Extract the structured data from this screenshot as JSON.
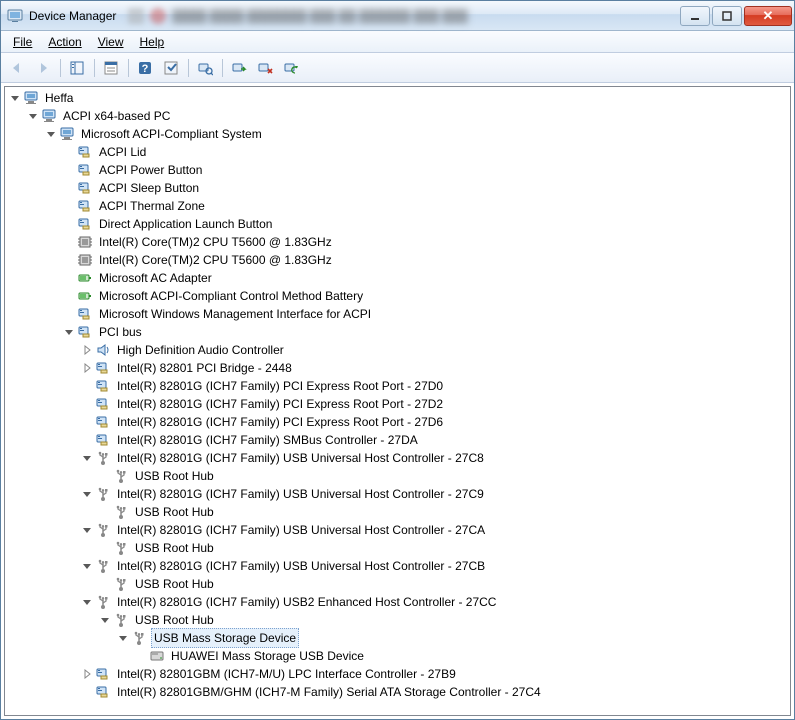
{
  "window": {
    "title": "Device Manager"
  },
  "menu": {
    "file": "File",
    "action": "Action",
    "view": "View",
    "help": "Help"
  },
  "tree": [
    {
      "depth": 0,
      "exp": "open",
      "icon": "computer",
      "label": "Heffa"
    },
    {
      "depth": 1,
      "exp": "open",
      "icon": "computer",
      "label": "ACPI x64-based PC"
    },
    {
      "depth": 2,
      "exp": "open",
      "icon": "computer",
      "label": "Microsoft ACPI-Compliant System"
    },
    {
      "depth": 3,
      "exp": "none",
      "icon": "system",
      "label": "ACPI Lid"
    },
    {
      "depth": 3,
      "exp": "none",
      "icon": "system",
      "label": "ACPI Power Button"
    },
    {
      "depth": 3,
      "exp": "none",
      "icon": "system",
      "label": "ACPI Sleep Button"
    },
    {
      "depth": 3,
      "exp": "none",
      "icon": "system",
      "label": "ACPI Thermal Zone"
    },
    {
      "depth": 3,
      "exp": "none",
      "icon": "system",
      "label": "Direct Application Launch Button"
    },
    {
      "depth": 3,
      "exp": "none",
      "icon": "cpu",
      "label": "Intel(R) Core(TM)2 CPU          T5600  @ 1.83GHz"
    },
    {
      "depth": 3,
      "exp": "none",
      "icon": "cpu",
      "label": "Intel(R) Core(TM)2 CPU          T5600  @ 1.83GHz"
    },
    {
      "depth": 3,
      "exp": "none",
      "icon": "battery",
      "label": "Microsoft AC Adapter"
    },
    {
      "depth": 3,
      "exp": "none",
      "icon": "battery",
      "label": "Microsoft ACPI-Compliant Control Method Battery"
    },
    {
      "depth": 3,
      "exp": "none",
      "icon": "system",
      "label": "Microsoft Windows Management Interface for ACPI"
    },
    {
      "depth": 3,
      "exp": "open",
      "icon": "system",
      "label": "PCI bus"
    },
    {
      "depth": 4,
      "exp": "closed",
      "icon": "sound",
      "label": "High Definition Audio Controller"
    },
    {
      "depth": 4,
      "exp": "closed",
      "icon": "system",
      "label": "Intel(R) 82801 PCI Bridge - 2448"
    },
    {
      "depth": 4,
      "exp": "none",
      "icon": "system",
      "label": "Intel(R) 82801G (ICH7 Family) PCI Express Root Port - 27D0"
    },
    {
      "depth": 4,
      "exp": "none",
      "icon": "system",
      "label": "Intel(R) 82801G (ICH7 Family) PCI Express Root Port - 27D2"
    },
    {
      "depth": 4,
      "exp": "none",
      "icon": "system",
      "label": "Intel(R) 82801G (ICH7 Family) PCI Express Root Port - 27D6"
    },
    {
      "depth": 4,
      "exp": "none",
      "icon": "system",
      "label": "Intel(R) 82801G (ICH7 Family) SMBus Controller - 27DA"
    },
    {
      "depth": 4,
      "exp": "open",
      "icon": "usb",
      "label": "Intel(R) 82801G (ICH7 Family) USB Universal Host Controller - 27C8"
    },
    {
      "depth": 5,
      "exp": "none",
      "icon": "usb",
      "label": "USB Root Hub"
    },
    {
      "depth": 4,
      "exp": "open",
      "icon": "usb",
      "label": "Intel(R) 82801G (ICH7 Family) USB Universal Host Controller - 27C9"
    },
    {
      "depth": 5,
      "exp": "none",
      "icon": "usb",
      "label": "USB Root Hub"
    },
    {
      "depth": 4,
      "exp": "open",
      "icon": "usb",
      "label": "Intel(R) 82801G (ICH7 Family) USB Universal Host Controller - 27CA"
    },
    {
      "depth": 5,
      "exp": "none",
      "icon": "usb",
      "label": "USB Root Hub"
    },
    {
      "depth": 4,
      "exp": "open",
      "icon": "usb",
      "label": "Intel(R) 82801G (ICH7 Family) USB Universal Host Controller - 27CB"
    },
    {
      "depth": 5,
      "exp": "none",
      "icon": "usb",
      "label": "USB Root Hub"
    },
    {
      "depth": 4,
      "exp": "open",
      "icon": "usb",
      "label": "Intel(R) 82801G (ICH7 Family) USB2 Enhanced Host Controller - 27CC"
    },
    {
      "depth": 5,
      "exp": "open",
      "icon": "usb",
      "label": "USB Root Hub"
    },
    {
      "depth": 6,
      "exp": "open",
      "icon": "usb",
      "label": "USB Mass Storage Device",
      "selected": true
    },
    {
      "depth": 7,
      "exp": "none",
      "icon": "disk",
      "label": "HUAWEI Mass Storage USB Device"
    },
    {
      "depth": 4,
      "exp": "closed",
      "icon": "system",
      "label": "Intel(R) 82801GBM (ICH7-M/U) LPC Interface Controller - 27B9"
    },
    {
      "depth": 4,
      "exp": "none",
      "icon": "system",
      "label": "Intel(R) 82801GBM/GHM (ICH7-M Family) Serial ATA Storage Controller - 27C4"
    }
  ]
}
